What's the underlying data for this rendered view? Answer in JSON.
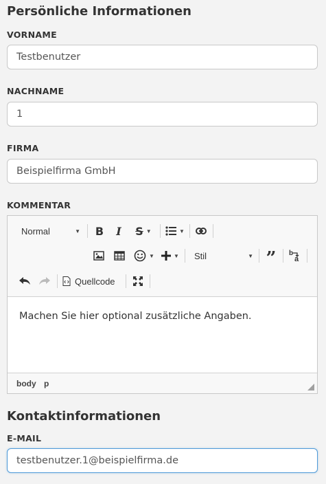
{
  "personal": {
    "title": "Persönliche Informationen",
    "firstname_label": "VORNAME",
    "firstname_value": "Testbenutzer",
    "lastname_label": "NACHNAME",
    "lastname_value": "1",
    "company_label": "FIRMA",
    "company_value": "Beispielfirma GmbH",
    "comment_label": "KOMMENTAR"
  },
  "editor": {
    "format_select": "Normal",
    "style_select": "Stil",
    "source_label": "Quellcode",
    "content": "Machen Sie hier optional zusätzliche Angaben.",
    "path": [
      "body",
      "p"
    ]
  },
  "contact": {
    "title": "Kontaktinformationen",
    "email_label": "E-MAIL",
    "email_value": "testbenutzer.1@beispielfirma.de"
  }
}
